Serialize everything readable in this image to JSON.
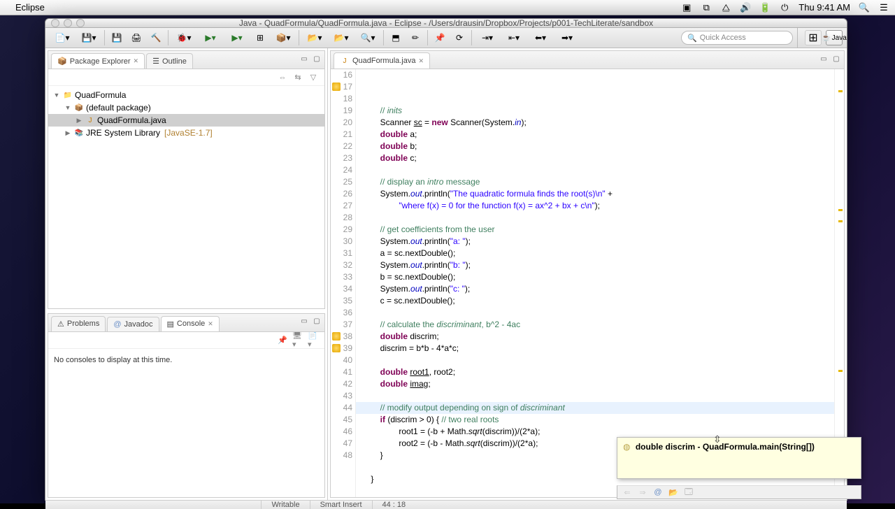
{
  "menubar": {
    "app": "Eclipse",
    "clock": "Thu 9:41 AM"
  },
  "window": {
    "title": "Java - QuadFormula/QuadFormula.java - Eclipse - /Users/drausin/Dropbox/Projects/p001-TechLiterate/sandbox"
  },
  "quickaccess": {
    "placeholder": "Quick Access"
  },
  "perspective": {
    "label": "Java"
  },
  "package_explorer": {
    "tab_label": "Package Explorer",
    "outline_label": "Outline",
    "project": "QuadFormula",
    "pkg": "(default package)",
    "file": "QuadFormula.java",
    "jre": "JRE System Library",
    "jre_ver": "[JavaSE-1.7]"
  },
  "bottom_view": {
    "problems": "Problems",
    "javadoc": "Javadoc",
    "console": "Console",
    "message": "No consoles to display at this time."
  },
  "editor": {
    "tab_label": "QuadFormula.java",
    "lines": [
      {
        "n": 16,
        "warn": false,
        "html": "<span class='cm'>// <span class='it'>inits</span></span>"
      },
      {
        "n": 17,
        "warn": true,
        "html": "Scanner <u>sc</u> = <span class='kw'>new</span> Scanner(System.<span class='fld'>in</span>);"
      },
      {
        "n": 18,
        "warn": false,
        "html": "<span class='kw'>double</span> a;"
      },
      {
        "n": 19,
        "warn": false,
        "html": "<span class='kw'>double</span> b;"
      },
      {
        "n": 20,
        "warn": false,
        "html": "<span class='kw'>double</span> c;"
      },
      {
        "n": 21,
        "warn": false,
        "html": ""
      },
      {
        "n": 22,
        "warn": false,
        "html": "<span class='cm'>// display an <span class='it'>intro</span> message</span>"
      },
      {
        "n": 23,
        "warn": false,
        "html": "System.<span class='fld'>out</span>.println(<span class='str'>\"The quadratic formula finds the root(s)\\n\"</span> +"
      },
      {
        "n": 24,
        "warn": false,
        "html": "        <span class='str'>\"where f(x) = 0 for the function f(x) = ax^2 + bx + c\\n\"</span>);"
      },
      {
        "n": 25,
        "warn": false,
        "html": ""
      },
      {
        "n": 26,
        "warn": false,
        "html": "<span class='cm'>// get coefficients from the user</span>"
      },
      {
        "n": 27,
        "warn": false,
        "html": "System.<span class='fld'>out</span>.println(<span class='str'>\"a: \"</span>);"
      },
      {
        "n": 28,
        "warn": false,
        "html": "a = sc.nextDouble();"
      },
      {
        "n": 29,
        "warn": false,
        "html": "System.<span class='fld'>out</span>.println(<span class='str'>\"b: \"</span>);"
      },
      {
        "n": 30,
        "warn": false,
        "html": "b = sc.nextDouble();"
      },
      {
        "n": 31,
        "warn": false,
        "html": "System.<span class='fld'>out</span>.println(<span class='str'>\"c: \"</span>);"
      },
      {
        "n": 32,
        "warn": false,
        "html": "c = sc.nextDouble();"
      },
      {
        "n": 33,
        "warn": false,
        "html": ""
      },
      {
        "n": 34,
        "warn": false,
        "html": "<span class='cm'>// calculate the <span class='it'>discriminant</span>, b^2 - 4ac</span>"
      },
      {
        "n": 35,
        "warn": false,
        "html": "<span class='kw'>double</span> discrim;"
      },
      {
        "n": 36,
        "warn": false,
        "html": "discrim = b*b - 4*a*c;"
      },
      {
        "n": 37,
        "warn": false,
        "html": ""
      },
      {
        "n": 38,
        "warn": true,
        "html": "<span class='kw'>double</span> <u>root1</u>, root2;"
      },
      {
        "n": 39,
        "warn": true,
        "html": "<span class='kw'>double</span> <u>imag</u>;"
      },
      {
        "n": 40,
        "warn": false,
        "html": ""
      },
      {
        "n": 41,
        "warn": false,
        "html": "<span class='cm'>// modify output depending on sign of <span class='it'>discriminant</span></span>"
      },
      {
        "n": 42,
        "warn": false,
        "html": "<span class='kw'>if</span> (discrim > 0) { <span class='cm'>// two real roots</span>"
      },
      {
        "n": 43,
        "warn": false,
        "html": "    root1 = (-b + Math.<span class='it'>sqrt</span>(discrim))/(2*a);"
      },
      {
        "n": 44,
        "warn": false,
        "html": "    root2 = (-b - Math.<span class='it'>sqrt</span>(discrim))/(2*a);"
      },
      {
        "n": 45,
        "warn": false,
        "html": "}"
      },
      {
        "n": 46,
        "warn": false,
        "html": ""
      },
      {
        "n": 47,
        "warn": false,
        "html": "}",
        "dedent": 1
      },
      {
        "n": 48,
        "warn": false,
        "html": ""
      }
    ],
    "highlight_line_index": 28
  },
  "tooltip": {
    "text": "double discrim - QuadFormula.main(String[])"
  },
  "statusbar": {
    "writable": "Writable",
    "insert": "Smart Insert",
    "pos": "44 : 18"
  }
}
